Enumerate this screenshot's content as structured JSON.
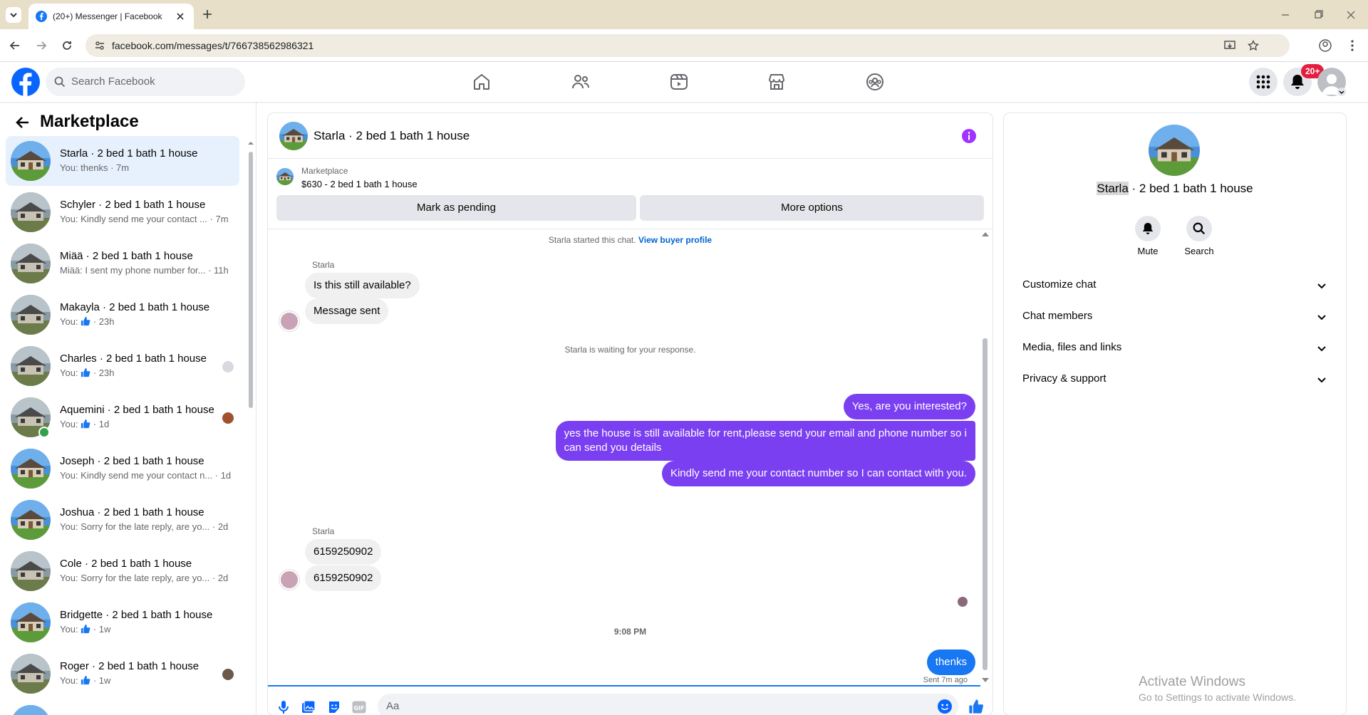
{
  "browser": {
    "tab_title": "(20+) Messenger | Facebook",
    "url": "facebook.com/messages/t/766738562986321"
  },
  "header": {
    "search_placeholder": "Search Facebook",
    "notif_badge": "20+"
  },
  "sidebar": {
    "title": "Marketplace",
    "conversations": [
      {
        "title": "Starla · 2 bed 1 bath 1 house",
        "sub": "You: thenks · 7m"
      },
      {
        "title": "Schyler · 2 bed 1 bath 1 house",
        "sub": "You: Kindly send me your contact ... · 7m"
      },
      {
        "title": "Miää · 2 bed 1 bath 1 house",
        "sub": "Miää: I sent my phone number for... · 11h"
      },
      {
        "title": "Makayla · 2 bed 1 bath 1 house",
        "sub_prefix": "You:",
        "sub_suffix": "· 23h"
      },
      {
        "title": "Charles · 2 bed 1 bath 1 house",
        "sub_prefix": "You:",
        "sub_suffix": "· 23h"
      },
      {
        "title": "Aquemini · 2 bed 1 bath 1 house",
        "sub_prefix": "You:",
        "sub_suffix": "· 1d"
      },
      {
        "title": "Joseph · 2 bed 1 bath 1 house",
        "sub": "You: Kindly send me your contact n... · 1d"
      },
      {
        "title": "Joshua · 2 bed 1 bath 1 house",
        "sub": "You: Sorry for the late reply, are yo... · 2d"
      },
      {
        "title": "Cole · 2 bed 1 bath 1 house",
        "sub": "You: Sorry for the late reply, are yo... · 2d"
      },
      {
        "title": "Bridgette · 2 bed 1 bath 1 house",
        "sub_prefix": "You:",
        "sub_suffix": "· 1w"
      },
      {
        "title": "Roger · 2 bed 1 bath 1 house",
        "sub_prefix": "You:",
        "sub_suffix": "· 1w"
      }
    ]
  },
  "chat": {
    "header_title": "Starla · 2 bed 1 bath 1 house",
    "listing_source": "Marketplace",
    "listing_text": "$630 - 2 bed 1 bath 1 house",
    "mark_pending": "Mark as pending",
    "more_options": "More options",
    "started_text": "Starla started this chat.",
    "view_buyer": "View buyer profile",
    "sender_name": "Starla",
    "msg1": "Is this still available?",
    "msg2": "Message sent",
    "waiting": "Starla is waiting for your response.",
    "out1": "Yes, are you interested?",
    "out2_line1": "yes the house is still available for rent,please send your email and phone number so i",
    "out2_line2": "can send you details",
    "out3": "Kindly send me your contact number so I can contact with you.",
    "sender_name2": "Starla",
    "phone1": "6159250902",
    "phone2": "6159250902",
    "time": "9:08 PM",
    "out4": "thenks",
    "sent_status": "Sent 7m ago",
    "composer_placeholder": "Aa"
  },
  "details": {
    "name_highlight": "Starla",
    "name_rest": " · 2 bed 1 bath 1 house",
    "mute": "Mute",
    "search": "Search",
    "rows": [
      "Customize chat",
      "Chat members",
      "Media, files and links",
      "Privacy & support"
    ]
  },
  "watermark": {
    "line1": "Activate Windows",
    "line2": "Go to Settings to activate Windows."
  },
  "colors": {
    "accent_purple": "#7b3ff2",
    "fb_blue": "#1877f2",
    "badge_red": "#e41e3f"
  }
}
